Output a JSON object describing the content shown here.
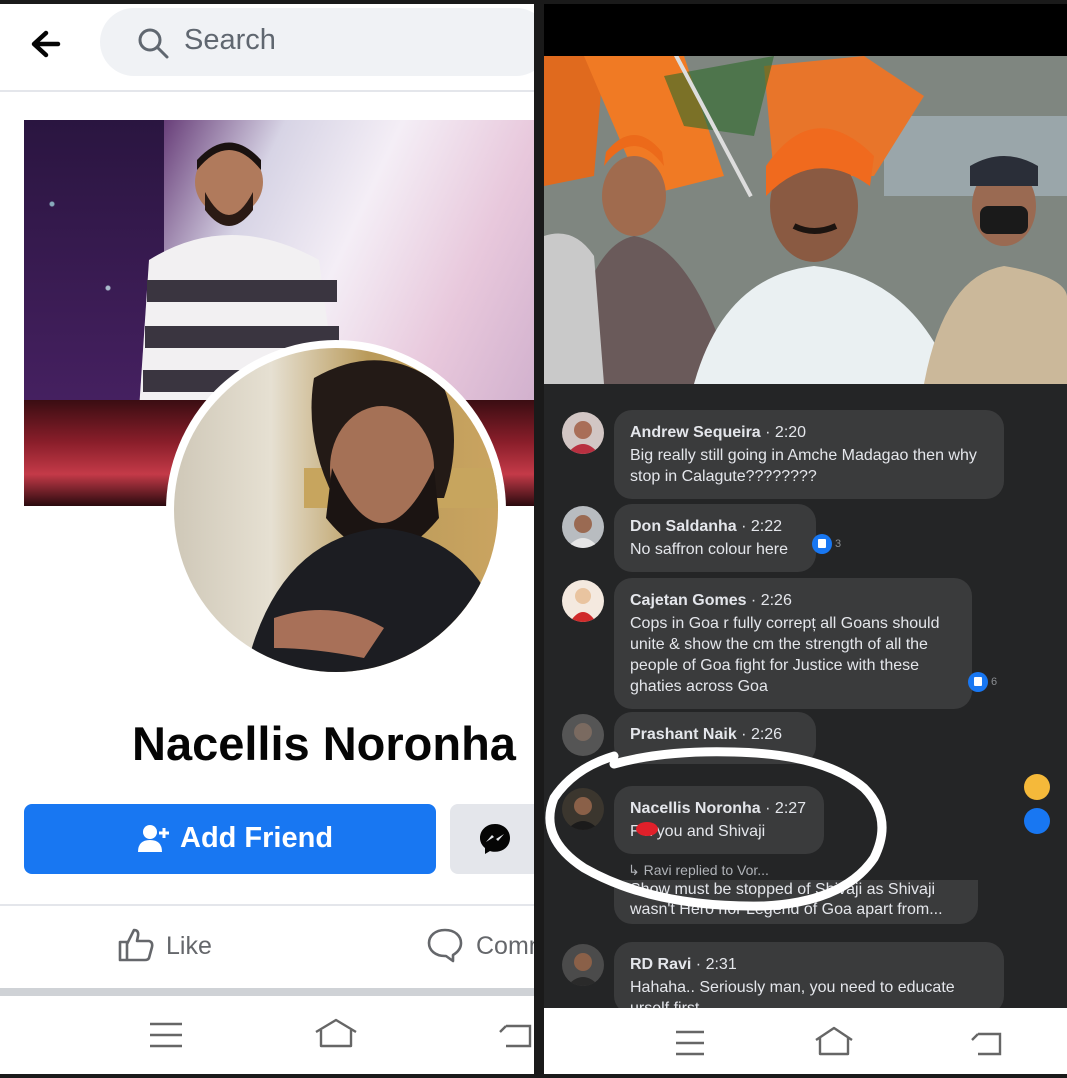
{
  "left_screen": {
    "search": {
      "placeholder": "Search"
    },
    "profile": {
      "name": "Nacellis Noronha"
    },
    "actions": {
      "add_friend_label": "Add Friend"
    },
    "reactions": {
      "like_label": "Like",
      "comment_label": "Comm"
    },
    "colors": {
      "brand_blue": "#1877f2",
      "text_dark": "#050505",
      "muted": "#65676b"
    }
  },
  "right_screen": {
    "comments": [
      {
        "author": "Andrew Sequeira",
        "time": "2:20",
        "text": "Big really still going in Amche Madagao then why stop in Calagute????????"
      },
      {
        "author": "Don Saldanha",
        "time": "2:22",
        "text": "No saffron colour here",
        "likes": "3"
      },
      {
        "author": "Cajetan Gomes",
        "time": "2:26",
        "text": "Cops in Goa r fully correpț all Goans should unite & show the cm the strength of all the people of Goa fight for Justice with these ghaties across Goa",
        "likes": "6"
      },
      {
        "author": "Prashant Naik",
        "time": "2:26",
        "text": ""
      },
      {
        "author": "Nacellis Noronha",
        "time": "2:27",
        "text": "F  k you and Shivaji"
      },
      {
        "author": "RD Ravi",
        "time": "2:31",
        "text": "Hahaha.. Seriously man, you need to educate urself first"
      }
    ],
    "reply_note": "Ravi replied to Vor...",
    "reply_excerpt": "Show must be stopped of Shivaji as Shivaji wasn't Hero nor Legend of Goa apart from..."
  },
  "icons": [
    "back-arrow-icon",
    "search-icon",
    "add-friend-icon",
    "messenger-icon",
    "like-icon",
    "comment-icon",
    "menu-icon",
    "home-icon",
    "back-nav-icon"
  ]
}
